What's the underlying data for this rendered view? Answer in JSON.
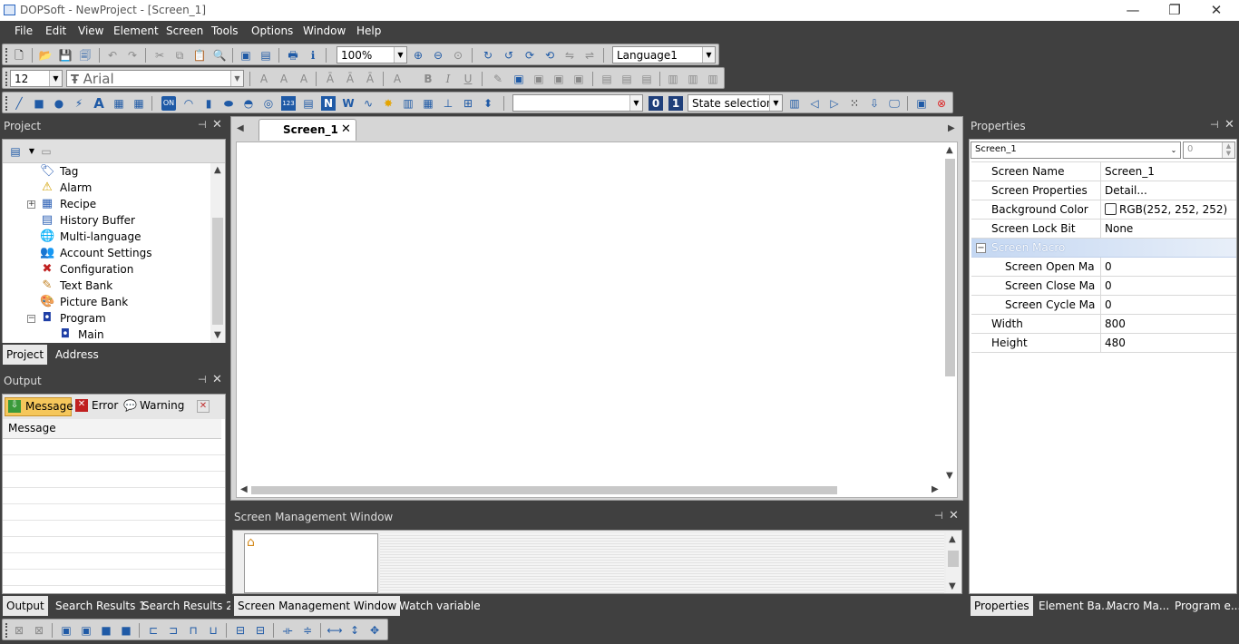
{
  "window": {
    "title": "DOPSoft - NewProject - [Screen_1]",
    "minimize": "—",
    "restore": "❐",
    "close": "✕"
  },
  "menu": [
    "File",
    "Edit",
    "View",
    "Element",
    "Screen",
    "Tools",
    "Options",
    "Window",
    "Help"
  ],
  "toolbar": {
    "zoom": "100%",
    "language": "Language1",
    "font_size": "12",
    "font_name": "Arial",
    "font_prefix": "Ŧ",
    "state_combo": "",
    "state_0": "0",
    "state_1": "1",
    "state_selection": "State selection..."
  },
  "project": {
    "title": "Project",
    "items": [
      {
        "label": "Tag",
        "icon": "tag-icon"
      },
      {
        "label": "Alarm",
        "icon": "alarm-icon"
      },
      {
        "label": "Recipe",
        "icon": "recipe-icon"
      },
      {
        "label": "History Buffer",
        "icon": "history-buffer-icon"
      },
      {
        "label": "Multi-language",
        "icon": "globe-icon"
      },
      {
        "label": "Account Settings",
        "icon": "account-icon"
      },
      {
        "label": "Configuration",
        "icon": "configuration-icon"
      },
      {
        "label": "Text Bank",
        "icon": "text-bank-icon"
      },
      {
        "label": "Picture Bank",
        "icon": "picture-bank-icon"
      },
      {
        "label": "Program",
        "icon": "program-icon"
      },
      {
        "label": "Main",
        "icon": "program-icon"
      }
    ],
    "tabs": [
      "Project",
      "Address"
    ]
  },
  "output": {
    "title": "Output",
    "filters": [
      "Message",
      "Error",
      "Warning"
    ],
    "column": "Message"
  },
  "editor": {
    "tab": "Screen_1"
  },
  "screen_mgmt": {
    "title": "Screen Management Window"
  },
  "bottom_tabs_left": [
    "Output",
    "Search Results 1",
    "Search Results 2"
  ],
  "bottom_tabs_mid": [
    "Screen Management Window",
    "Watch variable"
  ],
  "properties": {
    "title": "Properties",
    "selector": "Screen_1",
    "spin": "0",
    "rows": [
      {
        "key": "Screen Name",
        "value": "Screen_1"
      },
      {
        "key": "Screen Properties",
        "value": "Detail..."
      },
      {
        "key": "Background Color",
        "value": "RGB(252, 252, 252)"
      },
      {
        "key": "Screen Lock Bit",
        "value": "None"
      }
    ],
    "group": "Screen Macro",
    "group_rows": [
      {
        "key": "Screen Open Mac",
        "value": "0"
      },
      {
        "key": "Screen Close Macr",
        "value": "0"
      },
      {
        "key": "Screen Cycle Macr",
        "value": "0"
      }
    ],
    "rows2": [
      {
        "key": "Width",
        "value": "800"
      },
      {
        "key": "Height",
        "value": "480"
      }
    ],
    "bg_color": "#fcfcfc"
  },
  "bottom_tabs_right": [
    "Properties",
    "Element Ba...",
    "Macro Ma...",
    "Program e..."
  ],
  "colors": {
    "dark": "#404040",
    "selection": "#c9dbf5",
    "active_filter": "#f5c75b"
  }
}
